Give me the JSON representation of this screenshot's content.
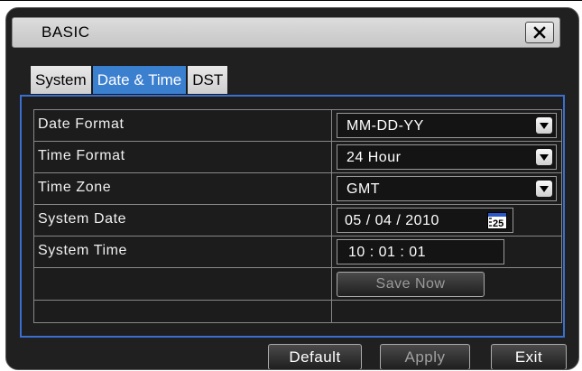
{
  "window": {
    "title": "BASIC",
    "close_icon": "close-icon"
  },
  "tabs": [
    {
      "label": "System",
      "active": false
    },
    {
      "label": "Date & Time",
      "active": true
    },
    {
      "label": "DST",
      "active": false
    }
  ],
  "settings": {
    "date_format": {
      "label": "Date Format",
      "value": "MM-DD-YY"
    },
    "time_format": {
      "label": "Time Format",
      "value": "24 Hour"
    },
    "time_zone": {
      "label": "Time Zone",
      "value": "GMT"
    },
    "system_date": {
      "label": "System Date",
      "value": "05 / 04 / 2010",
      "calendar_day": "25"
    },
    "system_time": {
      "label": "System Time",
      "value": "10 : 01 : 01"
    },
    "save_now": "Save Now"
  },
  "footer": {
    "default_label": "Default",
    "apply_label": "Apply",
    "exit_label": "Exit"
  },
  "colors": {
    "accent_tab": "#3b7fcf",
    "panel_border": "#3a6fd0",
    "background": "#202020"
  }
}
